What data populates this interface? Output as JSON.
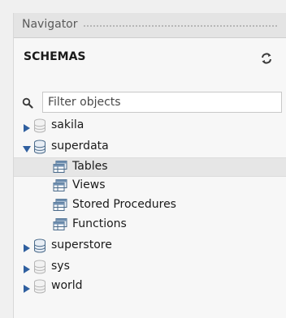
{
  "navigator": {
    "title": "Navigator",
    "section_label": "SCHEMAS",
    "filter_placeholder": "Filter objects"
  },
  "schemas": [
    {
      "name": "sakila",
      "expanded": false
    },
    {
      "name": "superdata",
      "expanded": true,
      "children": [
        "Tables",
        "Views",
        "Stored Procedures",
        "Functions"
      ]
    },
    {
      "name": "superstore",
      "expanded": false
    },
    {
      "name": "sys",
      "expanded": false
    },
    {
      "name": "world",
      "expanded": false
    }
  ],
  "selected_item": "Tables",
  "colors": {
    "accent_arrow": "#2f5f9f",
    "selection_bg": "#e6e6e6",
    "db_icon_gray": "#9a9a9a",
    "db_icon_blue": "#2e5a8a"
  },
  "icons": {
    "refresh": "refresh-icon",
    "search": "search-icon",
    "database": "database-icon",
    "table_group": "table-icon",
    "expand": "triangle-right-icon",
    "collapse": "triangle-down-icon"
  }
}
